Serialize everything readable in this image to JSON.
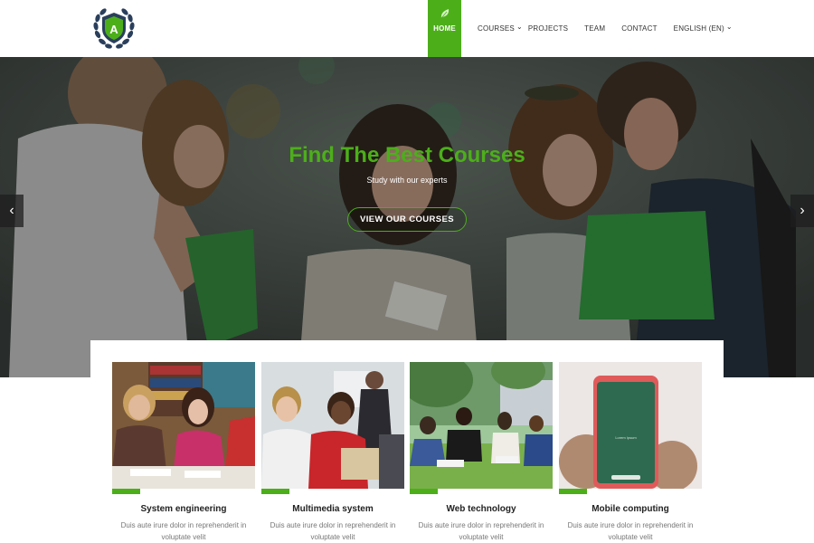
{
  "nav": {
    "items": [
      {
        "label": "HOME"
      },
      {
        "label": "COURSES"
      },
      {
        "label": "PROJECTS"
      },
      {
        "label": "TEAM"
      },
      {
        "label": "CONTACT"
      },
      {
        "label": "ENGLISH (EN)"
      }
    ]
  },
  "logo": {
    "letter": "A"
  },
  "hero": {
    "title": "Find The Best Courses",
    "subtitle": "Study with our experts",
    "button": "VIEW OUR COURSES",
    "prev_icon": "chevron-left-icon",
    "next_icon": "chevron-right-icon"
  },
  "cards": [
    {
      "title": "System engineering",
      "desc": "Duis aute irure dolor in reprehenderit in voluptate velit"
    },
    {
      "title": "Multimedia system",
      "desc": "Duis aute irure dolor in reprehenderit in voluptate velit"
    },
    {
      "title": "Web technology",
      "desc": "Duis aute irure dolor in reprehenderit in voluptate velit"
    },
    {
      "title": "Mobile computing",
      "desc": "Duis aute irure dolor in reprehenderit in voluptate velit"
    }
  ],
  "colors": {
    "accent": "#4caf1a"
  }
}
